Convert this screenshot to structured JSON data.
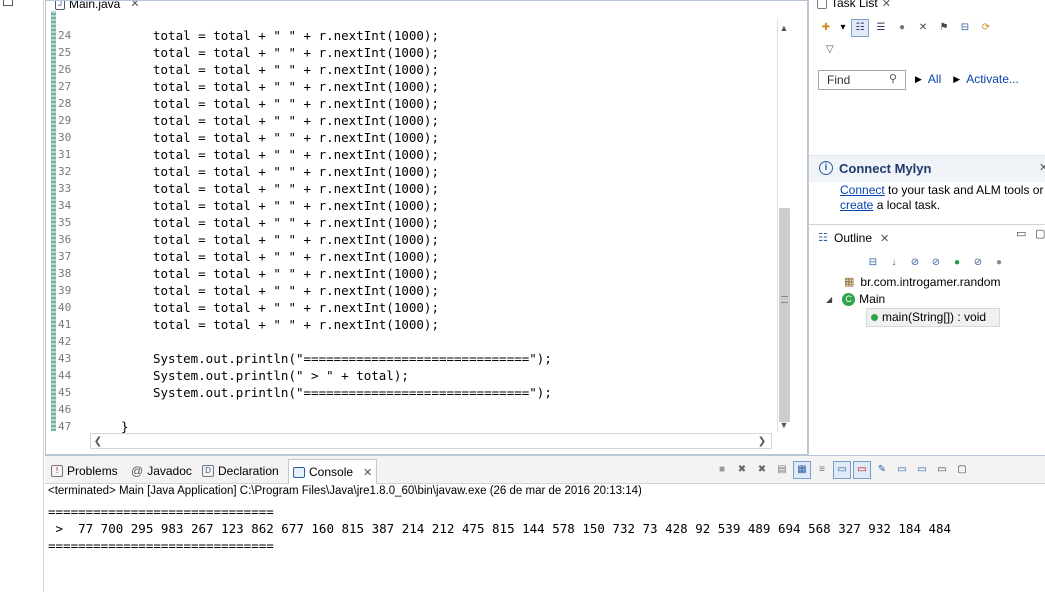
{
  "editor": {
    "tab_title": "Main.java",
    "lines": [
      {
        "n": "24",
        "code": "total = total + \" \" + r.nextInt(1000);"
      },
      {
        "n": "25",
        "code": "total = total + \" \" + r.nextInt(1000);"
      },
      {
        "n": "26",
        "code": "total = total + \" \" + r.nextInt(1000);"
      },
      {
        "n": "27",
        "code": "total = total + \" \" + r.nextInt(1000);"
      },
      {
        "n": "28",
        "code": "total = total + \" \" + r.nextInt(1000);"
      },
      {
        "n": "29",
        "code": "total = total + \" \" + r.nextInt(1000);"
      },
      {
        "n": "30",
        "code": "total = total + \" \" + r.nextInt(1000);"
      },
      {
        "n": "31",
        "code": "total = total + \" \" + r.nextInt(1000);"
      },
      {
        "n": "32",
        "code": "total = total + \" \" + r.nextInt(1000);"
      },
      {
        "n": "33",
        "code": "total = total + \" \" + r.nextInt(1000);"
      },
      {
        "n": "34",
        "code": "total = total + \" \" + r.nextInt(1000);"
      },
      {
        "n": "35",
        "code": "total = total + \" \" + r.nextInt(1000);"
      },
      {
        "n": "36",
        "code": "total = total + \" \" + r.nextInt(1000);"
      },
      {
        "n": "37",
        "code": "total = total + \" \" + r.nextInt(1000);"
      },
      {
        "n": "38",
        "code": "total = total + \" \" + r.nextInt(1000);"
      },
      {
        "n": "39",
        "code": "total = total + \" \" + r.nextInt(1000);"
      },
      {
        "n": "40",
        "code": "total = total + \" \" + r.nextInt(1000);"
      },
      {
        "n": "41",
        "code": "total = total + \" \" + r.nextInt(1000);"
      },
      {
        "n": "42",
        "code": ""
      },
      {
        "n": "43",
        "code": "System.out.println(\"==============================\");"
      },
      {
        "n": "44",
        "code": "System.out.println(\" > \" + total);"
      },
      {
        "n": "45",
        "code": "System.out.println(\"==============================\");"
      },
      {
        "n": "46",
        "code": ""
      },
      {
        "n": "47",
        "code": "}"
      }
    ]
  },
  "task_list": {
    "title": "Task List",
    "find_placeholder": "Find",
    "all_label": "All",
    "activate_label": "Activate..."
  },
  "mylyn": {
    "title": "Connect Mylyn",
    "connect_link": "Connect",
    "connect_rest": " to your task and ALM tools or",
    "create_link": "create",
    "create_rest": " a local task."
  },
  "outline": {
    "title": "Outline",
    "package": "br.com.introgamer.random",
    "class_name": "Main",
    "method": "main(String[]) : void"
  },
  "console": {
    "tabs": {
      "problems": "Problems",
      "javadoc": "Javadoc",
      "declaration": "Declaration",
      "console": "Console"
    },
    "status": "<terminated> Main [Java Application] C:\\Program Files\\Java\\jre1.8.0_60\\bin\\javaw.exe (26 de mar de 2016 20:13:14)",
    "output": [
      "==============================",
      " >  77 700 295 983 267 123 862 677 160 815 387 214 212 475 815 144 578 150 732 73 428 92 539 489 694 568 327 932 184 484",
      "=============================="
    ]
  }
}
